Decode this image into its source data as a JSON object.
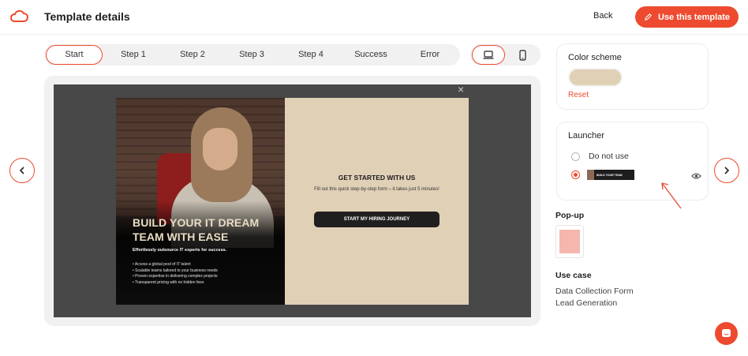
{
  "header": {
    "title": "Template details",
    "back_label": "Back",
    "use_label": "Use this template",
    "logo_icon": "cloud-logo-icon",
    "brand_color": "#ee4a2f"
  },
  "steps": {
    "tabs": [
      "Start",
      "Step 1",
      "Step 2",
      "Step 3",
      "Step 4",
      "Success",
      "Error"
    ],
    "active": "Start"
  },
  "devices": {
    "items": [
      "desktop-icon",
      "mobile-icon"
    ],
    "active": "desktop-icon"
  },
  "popup": {
    "close": "×",
    "headline_line1": "BUILD YOUR IT DREAM",
    "headline_line2": "TEAM WITH EASE",
    "subheadline": "Effortlessly outsource IT experts for success.",
    "bullets": [
      "• Access a global pool of IT talent",
      "• Scalable teams tailored to your business needs",
      "• Proven expertise in delivering complex projects",
      "• Transparent pricing with no hidden fees"
    ],
    "cta_title": "GET STARTED WITH US",
    "cta_text": "Fill out this quick step-by-step form – it takes just 5 minutes!",
    "cta_button": "START MY HIRING JOURNEY",
    "background_color": "#e0d0b6"
  },
  "sidebar": {
    "color_scheme": {
      "title": "Color scheme",
      "swatch": "#e0d0b6",
      "reset_label": "Reset"
    },
    "launcher": {
      "title": "Launcher",
      "options": [
        {
          "label": "Do not use",
          "selected": false
        },
        {
          "label": "",
          "selected": true,
          "thumb_text": "BUILD YOUR TEAM"
        }
      ],
      "preview_icon": "eye-icon"
    },
    "popup_section": {
      "title": "Pop-up"
    },
    "use_case": {
      "title": "Use case",
      "items": [
        "Data Collection Form",
        "Lead Generation"
      ]
    }
  }
}
